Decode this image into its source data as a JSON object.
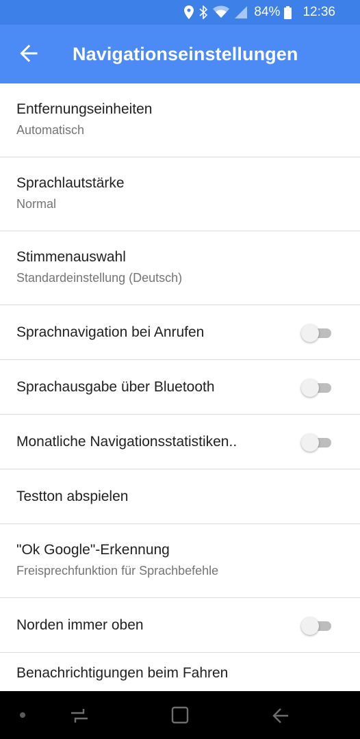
{
  "status_bar": {
    "icons": [
      "location-icon",
      "bluetooth-icon",
      "wifi-icon",
      "signal-icon",
      "battery-icon"
    ],
    "battery": "84%",
    "time": "12:36"
  },
  "app_bar": {
    "title": "Navigationseinstellungen",
    "back_icon": "arrow-back-icon"
  },
  "settings": [
    {
      "title": "Entfernungseinheiten",
      "subtitle": "Automatisch"
    },
    {
      "title": "Sprachlautstärke",
      "subtitle": "Normal"
    },
    {
      "title": "Stimmenauswahl",
      "subtitle": "Standardeinstellung (Deutsch)"
    },
    {
      "title": "Sprachnavigation bei Anrufen",
      "toggle": false
    },
    {
      "title": "Sprachausgabe über Bluetooth",
      "toggle": false
    },
    {
      "title": "Monatliche Navigationsstatistiken..",
      "toggle": false
    },
    {
      "title": "Testton abspielen"
    },
    {
      "title": "\"Ok Google\"-Erkennung",
      "subtitle": "Freisprechfunktion für Sprachbefehle"
    },
    {
      "title": "Norden immer oben",
      "toggle": false
    },
    {
      "title": "Benachrichtigungen beim Fahren",
      "toggle": false
    }
  ],
  "nav_bar": {
    "icons": [
      "dot-indicator-icon",
      "recent-apps-icon",
      "home-icon",
      "back-icon"
    ]
  },
  "colors": {
    "status_bar": "#3d80e8",
    "app_bar": "#4c8bf5",
    "nav_bar": "#000000",
    "toggle_off_track": "#bdbdbd",
    "toggle_off_knob": "#f1f1f1"
  }
}
